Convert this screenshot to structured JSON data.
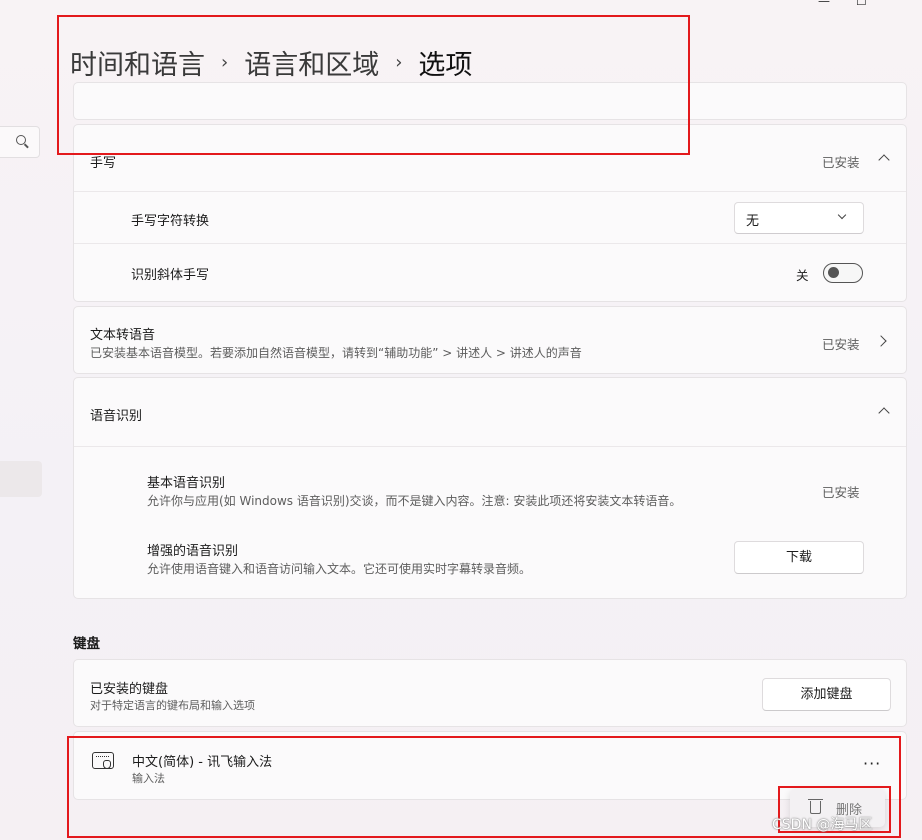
{
  "breadcrumb": {
    "items": [
      "时间和语言",
      "语言和区域"
    ],
    "current": "选项",
    "separator": "›"
  },
  "window_controls": {
    "minimize": "—",
    "maximize": "☐"
  },
  "handwriting": {
    "title": "手写",
    "status": "已安装",
    "char_convert": {
      "label": "手写字符转换",
      "value": "无"
    },
    "italic": {
      "label": "识别斜体手写",
      "state_label": "关",
      "on": false
    }
  },
  "tts": {
    "title": "文本转语音",
    "description": "已安装基本语音模型。若要添加自然语音模型，请转到“辅助功能” > 讲述人 > 讲述人的声音",
    "status": "已安装"
  },
  "speech": {
    "title": "语音识别",
    "basic": {
      "title": "基本语音识别",
      "description": "允许你与应用(如 Windows 语音识别)交谈，而不是键入内容。注意: 安装此项还将安装文本转语音。",
      "status": "已安装"
    },
    "enhanced": {
      "title": "增强的语音识别",
      "description": "允许使用语音键入和语音访问输入文本。它还可使用实时字幕转录音频。",
      "button": "下载"
    }
  },
  "keyboard": {
    "section_title": "键盘",
    "installed": {
      "title": "已安装的键盘",
      "description": "对于特定语言的键布局和输入选项",
      "button": "添加键盘"
    },
    "items": [
      {
        "name": "中文(简体) - 讯飞输入法",
        "type": "输入法",
        "more": "···"
      }
    ],
    "context_menu": {
      "delete": "删除"
    }
  },
  "watermark": "CSDN @海马区",
  "colors": {
    "highlight": "#e3191c",
    "background": "#f6f2f4",
    "card": "#fbfafb"
  }
}
